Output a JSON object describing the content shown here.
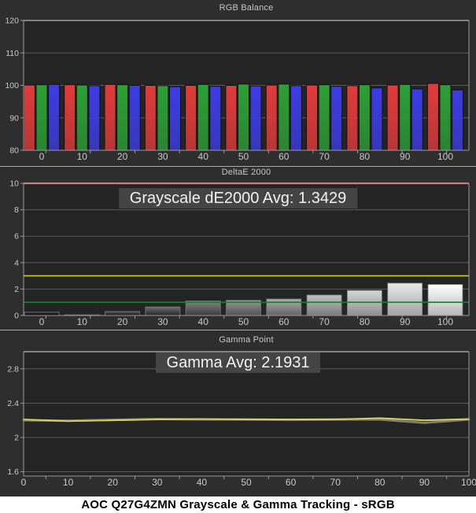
{
  "banner": {
    "title": "AOC Q27G4ZMN Grayscale & Gamma Tracking - sRGB"
  },
  "colors": {
    "page_bg": "#2e2e2e",
    "plot_bg": "#242424",
    "gridline": "#5c5c5c",
    "border": "#9a9a9a",
    "tick_label": "#c9c9c9",
    "bar_red": "#e23b3b",
    "bar_green": "#2ca035",
    "bar_blue": "#3c3ce6",
    "ref_red": "#a33b3a",
    "ref_yellow": "#d9cb31",
    "ref_green": "#1f7e2d",
    "gamma_yellow": "#ddd45a",
    "gamma_gray": "#8f8f83"
  },
  "chart_data": [
    {
      "type": "bar",
      "title": "RGB Balance",
      "categories": [
        0,
        10,
        20,
        30,
        40,
        50,
        60,
        70,
        80,
        90,
        100
      ],
      "series": [
        {
          "name": "Red",
          "color": "#e23b3b",
          "values": [
            100.1,
            100.2,
            100.3,
            100.0,
            100.0,
            100.0,
            100.1,
            100.1,
            99.9,
            100.1,
            100.6
          ]
        },
        {
          "name": "Green",
          "color": "#2ca035",
          "values": [
            100.2,
            100.1,
            100.2,
            99.9,
            100.3,
            100.4,
            100.4,
            100.2,
            100.2,
            100.3,
            100.2
          ]
        },
        {
          "name": "Blue",
          "color": "#3c3ce6",
          "values": [
            100.3,
            99.9,
            100.0,
            99.6,
            99.7,
            99.8,
            99.9,
            99.7,
            99.2,
            98.9,
            98.6
          ]
        }
      ],
      "xlabel": "",
      "ylabel": "",
      "ylim": [
        80,
        120
      ],
      "yticks": [
        80,
        90,
        100,
        110,
        120
      ],
      "grid": true,
      "legend": "none"
    },
    {
      "type": "bar",
      "title": "DeltaE 2000",
      "overlay": "Grayscale dE2000 Avg: 1.3429",
      "categories": [
        0,
        10,
        20,
        30,
        40,
        50,
        60,
        70,
        80,
        90,
        100
      ],
      "values": [
        0.25,
        0.05,
        0.3,
        0.65,
        1.1,
        1.15,
        1.25,
        1.55,
        1.9,
        2.45,
        2.35
      ],
      "xlabel": "",
      "ylabel": "",
      "ylim": [
        0,
        10
      ],
      "yticks": [
        0,
        2,
        4,
        6,
        8,
        10
      ],
      "grid": true,
      "bar_style": "grayscale-by-level",
      "ref_lines": [
        {
          "y": 10,
          "color": "#a33b3a",
          "name": "max-limit"
        },
        {
          "y": 3,
          "color": "#d9cb31",
          "name": "warning-level"
        },
        {
          "y": 1,
          "color": "#1f7e2d",
          "name": "target-level"
        }
      ]
    },
    {
      "type": "line",
      "title": "Gamma Point",
      "overlay": "Gamma Avg: 2.1931",
      "x": [
        0,
        10,
        20,
        30,
        40,
        50,
        60,
        70,
        80,
        90,
        100
      ],
      "series": [
        {
          "name": "Reference",
          "color": "#8f8f83",
          "values": [
            2.2,
            2.195,
            2.205,
            2.215,
            2.21,
            2.21,
            2.205,
            2.21,
            2.21,
            2.17,
            2.21
          ]
        },
        {
          "name": "Measured Gamma",
          "color": "#ddd45a",
          "values": [
            2.21,
            2.19,
            2.2,
            2.21,
            2.215,
            2.21,
            2.21,
            2.21,
            2.225,
            2.2,
            2.215
          ]
        }
      ],
      "xlabel": "",
      "ylabel": "",
      "ylim": [
        1.55,
        3.0
      ],
      "yticks": [
        1.6,
        2,
        2.4,
        2.8
      ],
      "grid": true,
      "legend": "none"
    }
  ]
}
